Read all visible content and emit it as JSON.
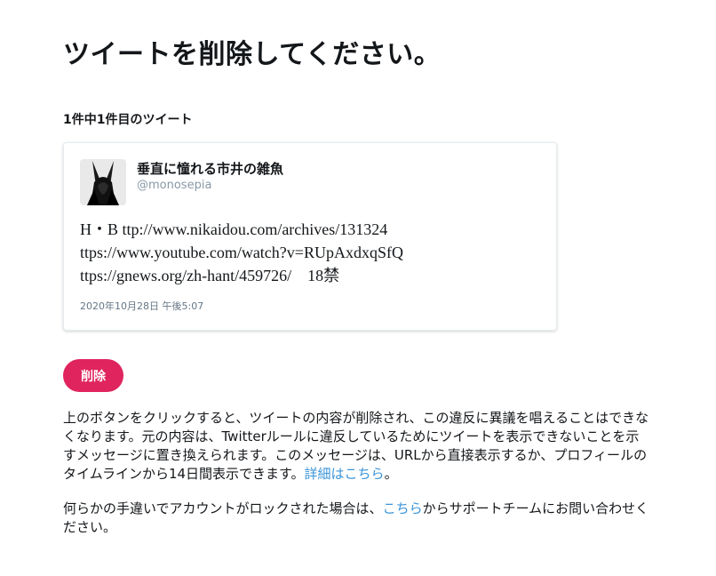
{
  "page": {
    "title": "ツイートを削除してください。",
    "counter": "1件中1件目のツイート"
  },
  "tweet": {
    "display_name": "垂直に憧れる市井の雑魚",
    "screen_name": "@monosepia",
    "avatar_icon": "rabbit-silhouette-avatar",
    "lines": [
      "H・B ttp://www.nikaidou.com/archives/131324",
      "ttps://www.youtube.com/watch?v=RUpAxdxqSfQ",
      "ttps://gnews.org/zh-hant/459726/　18禁"
    ],
    "timestamp": "2020年10月28日 午後5:07"
  },
  "delete_button": {
    "label": "削除",
    "color": "#e0245e"
  },
  "explanation": {
    "text": "上のボタンをクリックすると、ツイートの内容が削除され、この違反に異議を唱えることはできなくなります。元の内容は、Twitterルールに違反しているためにツイートを表示できないことを示すメッセージに置き換えられます。このメッセージは、URLから直接表示するか、プロフィールのタイムラインから14日間表示できます。",
    "link_label": "詳細はこちら",
    "suffix": "。"
  },
  "support": {
    "prefix": "何らかの手違いでアカウントがロックされた場合は、",
    "link_label": "こちら",
    "suffix": "からサポートチームにお問い合わせください。"
  },
  "colors": {
    "link": "#3b94d9",
    "muted": "#657786"
  }
}
